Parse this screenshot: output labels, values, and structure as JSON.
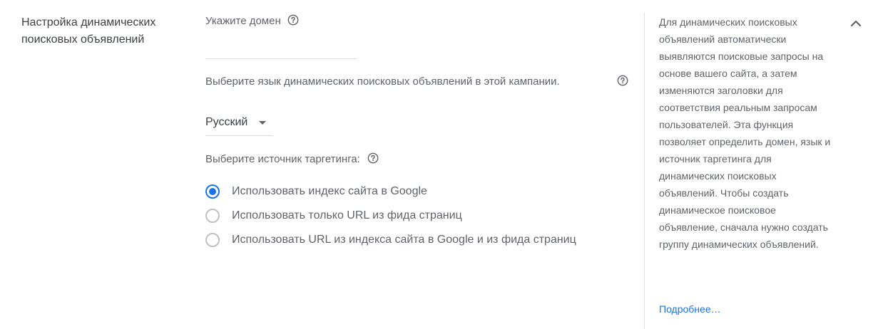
{
  "section": {
    "title": "Настройка динамических поисковых объявлений"
  },
  "domain": {
    "label": "Укажите домен",
    "value": "",
    "help_icon": "help-circle-icon"
  },
  "language": {
    "label": "Выберите язык динамических поисковых объявлений в этой кампании.",
    "selected": "Русский",
    "help_icon": "help-circle-icon",
    "dropdown_icon": "caret-down-icon"
  },
  "targeting": {
    "label": "Выберите источник таргетинга:",
    "help_icon": "help-circle-icon",
    "options": [
      {
        "label": "Использовать индекс сайта в Google",
        "selected": true
      },
      {
        "label": "Использовать только URL из фида страниц",
        "selected": false
      },
      {
        "label": "Использовать URL из индекса сайта в Google и из фида страниц",
        "selected": false
      }
    ]
  },
  "help_panel": {
    "text": "Для динамических поисковых объявлений автоматически выявляются поисковые запросы на основе вашего сайта, а затем изменяются заголовки для соответствия реальным запросам пользователей. Эта функция позволяет определить домен, язык и источник таргетинга для динамических поисковых объявлений. Чтобы создать динамическое поисковое объявление, сначала нужно создать группу динамических объявлений.",
    "link": "Подробнее…"
  },
  "collapse_icon": "chevron-up-icon",
  "colors": {
    "accent": "#1a73e8",
    "text_primary": "#3c4043",
    "text_secondary": "#5f6368",
    "divider": "#e0e0e0"
  }
}
